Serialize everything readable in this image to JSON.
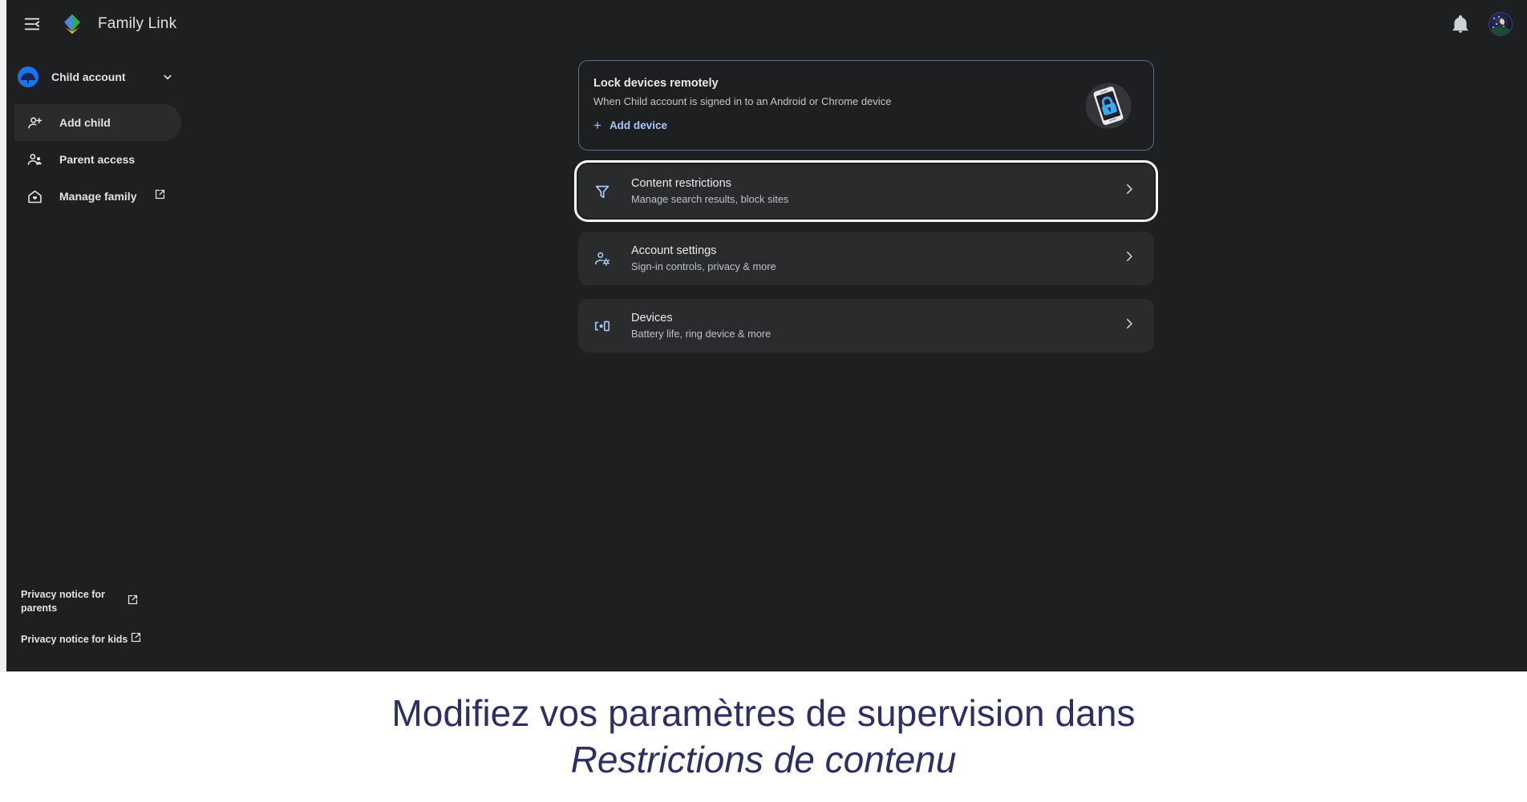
{
  "app": {
    "title": "Family Link",
    "logo_icon": "family-link-kite-logo",
    "menu_icon": "menu-collapse-icon",
    "notifications_icon": "bell-icon",
    "avatar_icon": "user-avatar-night-sky"
  },
  "sidebar": {
    "account": {
      "name": "Child account",
      "avatar_icon": "child-avatar-icon",
      "caret_icon": "chevron-down-icon"
    },
    "items": [
      {
        "label": "Add child",
        "icon": "person-add-icon",
        "selected": true,
        "external": false
      },
      {
        "label": "Parent access",
        "icon": "people-icon",
        "selected": false,
        "external": false
      },
      {
        "label": "Manage family",
        "icon": "home-heart-icon",
        "selected": false,
        "external": true
      }
    ],
    "footer_links": [
      {
        "label": "Privacy notice for parents",
        "icon": "external-link-icon"
      },
      {
        "label": "Privacy notice for kids",
        "icon": "external-link-icon"
      }
    ]
  },
  "main": {
    "lock_card": {
      "title": "Lock devices remotely",
      "subtitle": "When Child account is signed in to an Android or Chrome device",
      "action_label": "Add device",
      "action_icon": "plus-icon",
      "illustration_icon": "phone-lock-illustration"
    },
    "cards": [
      {
        "title": "Content restrictions",
        "subtitle": "Manage search results, block sites",
        "icon": "filter-funnel-icon",
        "chevron_icon": "chevron-right-icon",
        "focused": true
      },
      {
        "title": "Account settings",
        "subtitle": "Sign-in controls, privacy & more",
        "icon": "person-settings-icon",
        "chevron_icon": "chevron-right-icon",
        "focused": false
      },
      {
        "title": "Devices",
        "subtitle": "Battery life, ring device & more",
        "icon": "devices-icon",
        "chevron_icon": "chevron-right-icon",
        "focused": false
      }
    ]
  },
  "caption": {
    "line1": "Modifiez vos paramètres de supervision dans",
    "line2": "Restrictions de contenu"
  },
  "colors": {
    "background": "#1e1f20",
    "card": "#2a2b2d",
    "accent_blue": "#a8c7fa",
    "text_primary": "#e8eaed",
    "text_secondary": "#bdc1c6",
    "caption_text": "#2b2f63",
    "focus_ring": "#ffffff"
  }
}
